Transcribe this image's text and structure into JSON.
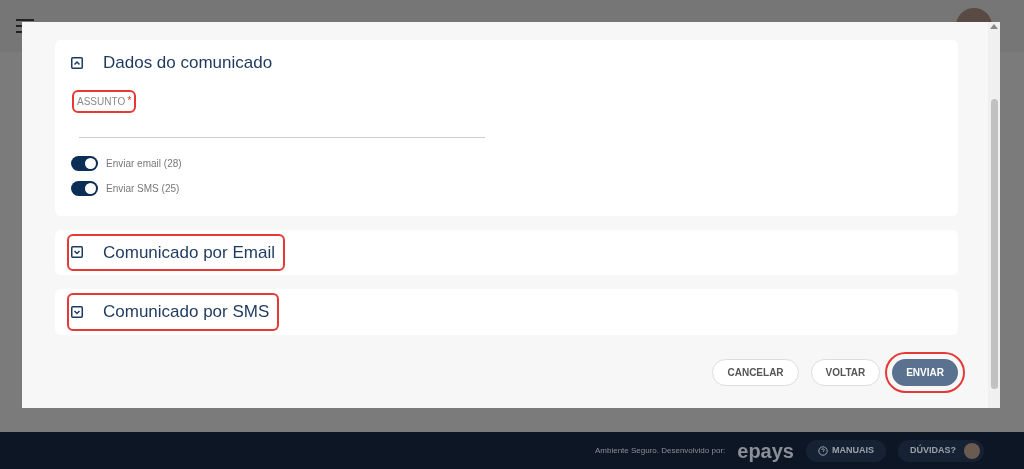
{
  "sections": [
    {
      "title": "Dados do comunicado",
      "expanded": true,
      "highlighted": false,
      "field": {
        "label": "ASSUNTO",
        "required_mark": "*",
        "highlighted": true
      },
      "toggles": [
        {
          "label": "Enviar email (28)",
          "on": true
        },
        {
          "label": "Enviar SMS (25)",
          "on": true
        }
      ]
    },
    {
      "title": "Comunicado por Email",
      "expanded": false,
      "highlighted": true
    },
    {
      "title": "Comunicado por SMS",
      "expanded": false,
      "highlighted": true
    }
  ],
  "buttons": [
    {
      "label": "CANCELAR",
      "kind": "outline",
      "highlighted": false
    },
    {
      "label": "VOLTAR",
      "kind": "outline",
      "highlighted": false
    },
    {
      "label": "ENVIAR",
      "kind": "primary",
      "highlighted": true
    }
  ],
  "footer": {
    "note": "Ambiente Seguro. Desenvolvido por:",
    "brand": "epays",
    "manuals": "MANUAIS",
    "help": "DÚVIDAS?"
  }
}
